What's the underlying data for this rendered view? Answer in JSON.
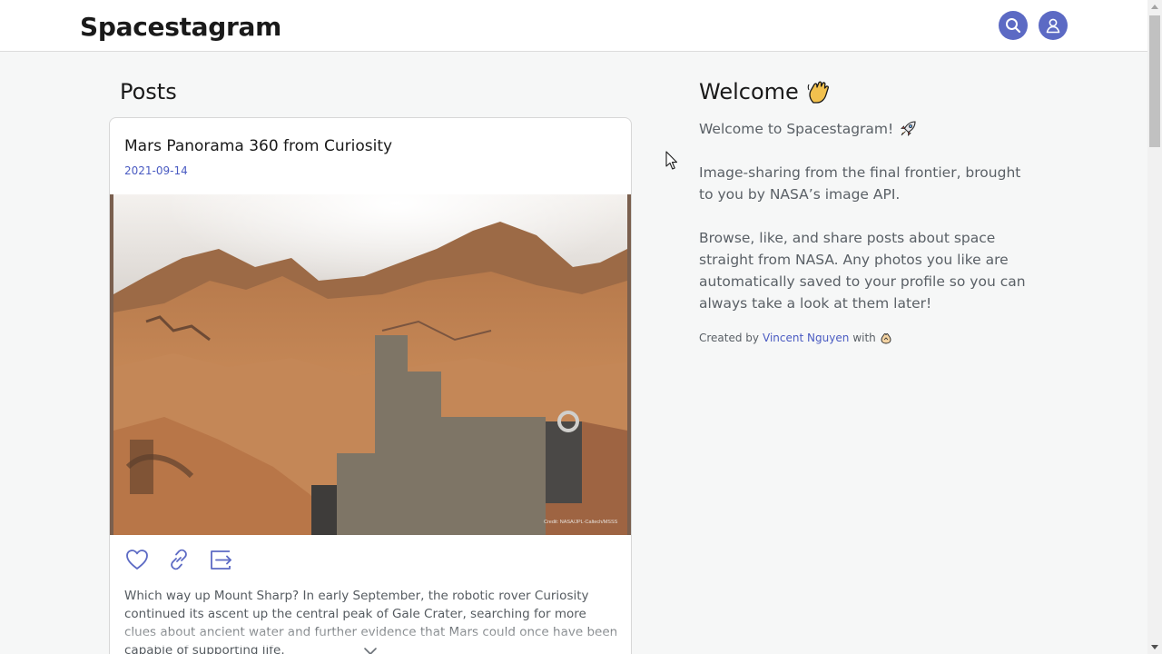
{
  "app": {
    "brand": "Spacestagram"
  },
  "header": {
    "search_icon": "search-icon",
    "account_icon": "user-icon",
    "accent_color": "#5c6ac4"
  },
  "posts": {
    "heading": "Posts",
    "items": [
      {
        "title": "Mars Panorama 360 from Curiosity",
        "date": "2021-09-14",
        "photo_credit": "Credit: NASA/JPL-Caltech/MSSS",
        "actions": [
          "heart-icon",
          "link-icon",
          "share-icon"
        ],
        "description": "Which way up Mount Sharp? In early September, the robotic rover Curiosity continued its ascent up the central peak of Gale Crater, searching for more clues about ancient water and further evidence that Mars could once have been capable of supporting life."
      }
    ]
  },
  "welcome": {
    "heading": "Welcome",
    "line1": "Welcome to Spacestagram!",
    "line2": "Image-sharing from the final frontier, brought to you by NASA’s image API.",
    "line3": "Browse, like, and share posts about space straight from NASA. Any photos you like are automatically saved to your profile so you can always take a look at them later!",
    "credit_prefix": "Created by",
    "credit_author": "Vincent Nguyen",
    "credit_suffix": "with"
  }
}
